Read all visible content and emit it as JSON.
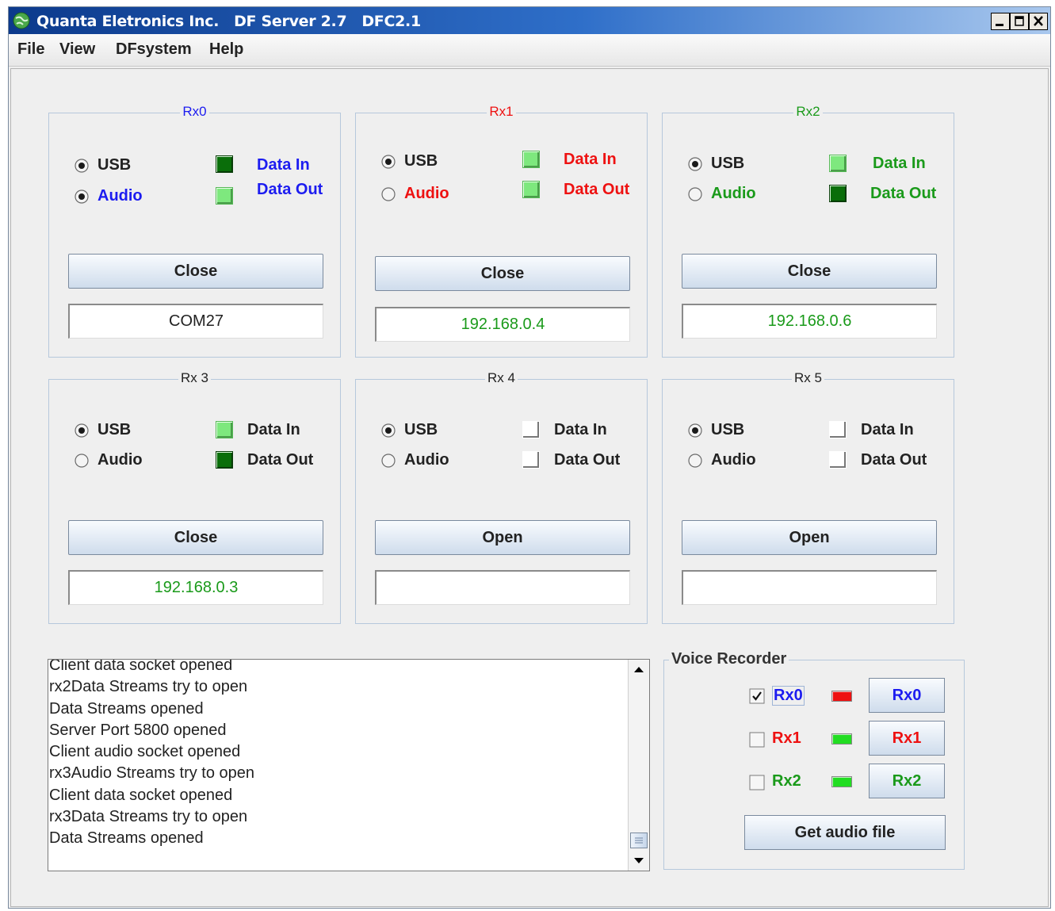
{
  "window": {
    "title": "Quanta Eletronics Inc.   DF Server 2.7   DFC2.1",
    "controls": {
      "minimize": "minimize-icon",
      "restore": "restore-icon",
      "close": "close-icon"
    }
  },
  "menu": {
    "items": [
      "File",
      "View",
      "DFsystem",
      "Help"
    ]
  },
  "colors": {
    "blue": "#1c1cf0",
    "red": "#ee1111",
    "green": "#1a9a1a",
    "dark": "#222222",
    "led_on": "#0a6e0a",
    "led_light": "#7ee87e",
    "rec_red": "#ee1111",
    "rec_green": "#22dd22"
  },
  "receivers": [
    {
      "title": "Rx0",
      "usb_label": "USB",
      "audio_label": "Audio",
      "data_in": "Data In",
      "data_out": "Data Out",
      "usb_selected": true,
      "audio_selected": true,
      "led_in": "on",
      "led_out": "light",
      "button": "Close",
      "field": "COM27"
    },
    {
      "title": "Rx1",
      "usb_label": "USB",
      "audio_label": "Audio",
      "data_in": "Data In",
      "data_out": "Data Out",
      "usb_selected": true,
      "audio_selected": false,
      "led_in": "light",
      "led_out": "light",
      "button": "Close",
      "field": "192.168.0.4"
    },
    {
      "title": "Rx2",
      "usb_label": "USB",
      "audio_label": "Audio",
      "data_in": "Data In",
      "data_out": "Data Out",
      "usb_selected": true,
      "audio_selected": false,
      "led_in": "light",
      "led_out": "on",
      "button": "Close",
      "field": "192.168.0.6"
    },
    {
      "title": "Rx 3",
      "usb_label": "USB",
      "audio_label": "Audio",
      "data_in": "Data In",
      "data_out": "Data Out",
      "usb_selected": true,
      "audio_selected": false,
      "led_in": "light",
      "led_out": "on",
      "button": "Close",
      "field": "192.168.0.3"
    },
    {
      "title": "Rx 4",
      "usb_label": "USB",
      "audio_label": "Audio",
      "data_in": "Data In",
      "data_out": "Data Out",
      "usb_selected": true,
      "audio_selected": false,
      "led_in": "off",
      "led_out": "off",
      "button": "Open",
      "field": ""
    },
    {
      "title": "Rx 5",
      "usb_label": "USB",
      "audio_label": "Audio",
      "data_in": "Data In",
      "data_out": "Data Out",
      "usb_selected": true,
      "audio_selected": false,
      "led_in": "off",
      "led_out": "off",
      "button": "Open",
      "field": ""
    }
  ],
  "log": {
    "lines": [
      "Client  data socket opened",
      "rx2Data Streams try to open",
      "Data Streams opened",
      "Server Port 5800 opened",
      "Client audio socket opened",
      "rx3Audio Streams try to open",
      "Client  data socket opened",
      "rx3Data Streams try to open",
      "Data Streams opened"
    ]
  },
  "voice_recorder": {
    "title": "Voice Recorder",
    "rows": [
      {
        "label": "Rx0",
        "checked": true,
        "indicator": "red",
        "button": "Rx0"
      },
      {
        "label": "Rx1",
        "checked": false,
        "indicator": "green",
        "button": "Rx1"
      },
      {
        "label": "Rx2",
        "checked": false,
        "indicator": "green",
        "button": "Rx2"
      }
    ],
    "get_audio": "Get audio file"
  }
}
